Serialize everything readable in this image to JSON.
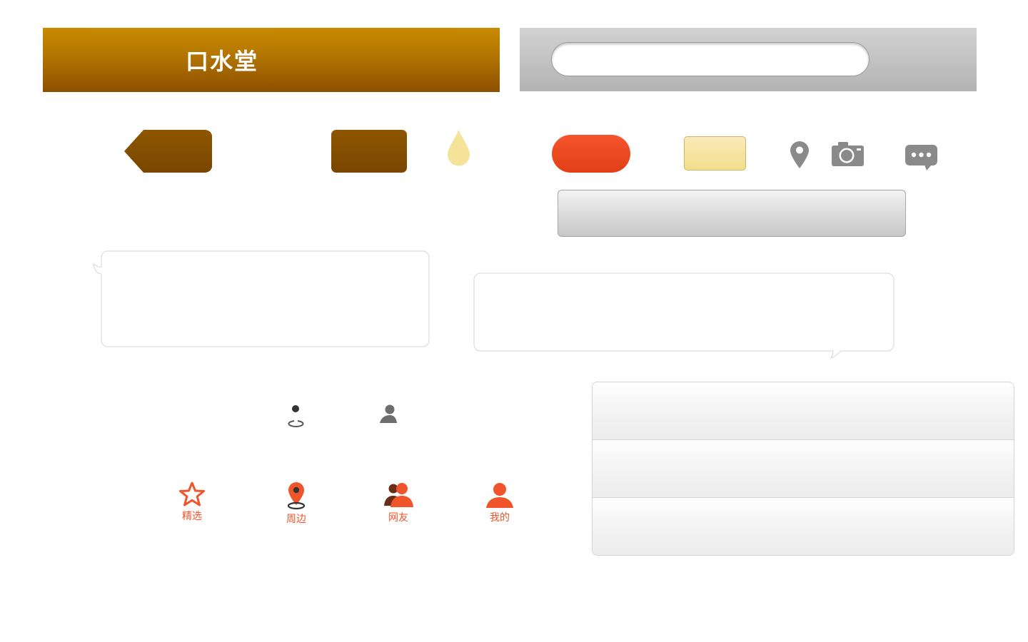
{
  "header": {
    "title": "口水堂",
    "brand_color_top": "#c98a00",
    "brand_color_bottom": "#8d5000"
  },
  "search": {
    "value": "",
    "placeholder": ""
  },
  "buttons": {
    "back": "",
    "brown": "",
    "red": "",
    "yellow": "",
    "gray_bar": ""
  },
  "icons": {
    "drop": "drop-icon",
    "location": "location-pin-icon",
    "camera": "camera-icon",
    "chat": "chat-bubble-icon",
    "nearby_small": "nearby-icon",
    "user_small": "user-icon"
  },
  "tabbar": {
    "accent": "#f0542b",
    "items": [
      {
        "label": "精选",
        "icon": "star-icon"
      },
      {
        "label": "周边",
        "icon": "location-pin-icon"
      },
      {
        "label": "网友",
        "icon": "friends-icon"
      },
      {
        "label": "我的",
        "icon": "user-icon"
      }
    ]
  },
  "list": {
    "rows": [
      "",
      "",
      ""
    ]
  }
}
